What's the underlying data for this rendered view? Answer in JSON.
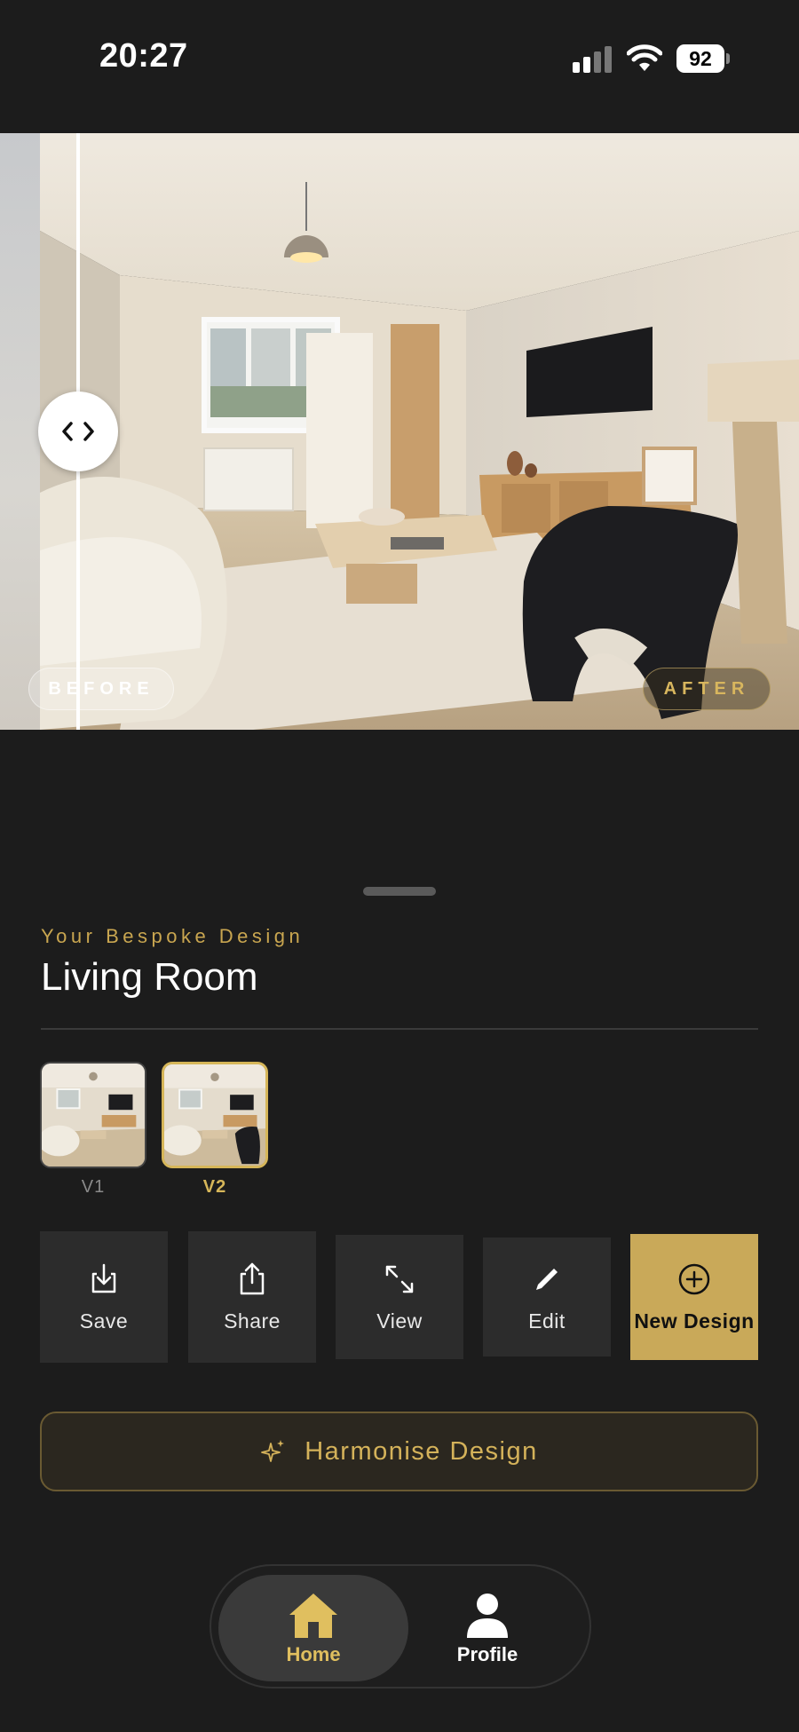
{
  "status_bar": {
    "time": "20:27",
    "battery": "92"
  },
  "comparison": {
    "before_label": "BEFORE",
    "after_label": "AFTER"
  },
  "design": {
    "subtitle": "Your Bespoke Design",
    "room_title": "Living Room"
  },
  "versions": [
    {
      "label": "V1",
      "selected": false
    },
    {
      "label": "V2",
      "selected": true
    }
  ],
  "actions": {
    "save": "Save",
    "share": "Share",
    "view": "View",
    "edit": "Edit",
    "new_design": "New Design"
  },
  "harmonise": {
    "label": "Harmonise Design"
  },
  "tabbar": {
    "home": "Home",
    "profile": "Profile",
    "active": "Home"
  },
  "colors": {
    "accent": "#c9a959",
    "background": "#1c1c1c",
    "card": "#2c2c2c"
  }
}
